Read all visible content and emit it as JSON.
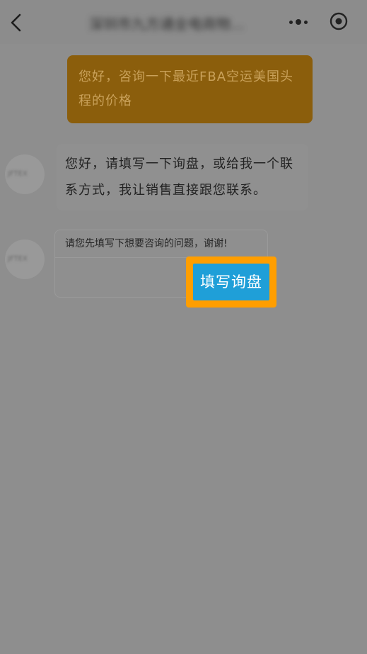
{
  "header": {
    "title": "深圳市九方通全电商物...",
    "back_icon": "chevron-left-icon",
    "more_icon": "more-dots-icon",
    "record_icon": "record-target-icon"
  },
  "messages": {
    "outgoing": {
      "text": "您好，咨询一下最近FBA空运美国头程的价格"
    },
    "incoming_1": {
      "avatar_text": "JFTEX",
      "text": "您好，请填写一下询盘，或给我一个联系方式，我让销售直接跟您联系。"
    },
    "incoming_2": {
      "avatar_text": "JFTEX",
      "card_text": "请您先填写下想要咨询的问题，谢谢!",
      "button_label": "填写询盘"
    }
  },
  "colors": {
    "overlay_bg": "#8e8e8e",
    "outgoing_bubble": "#8b5e0c",
    "highlight_border": "#ff9e00",
    "button_blue": "#1f9fd8"
  }
}
